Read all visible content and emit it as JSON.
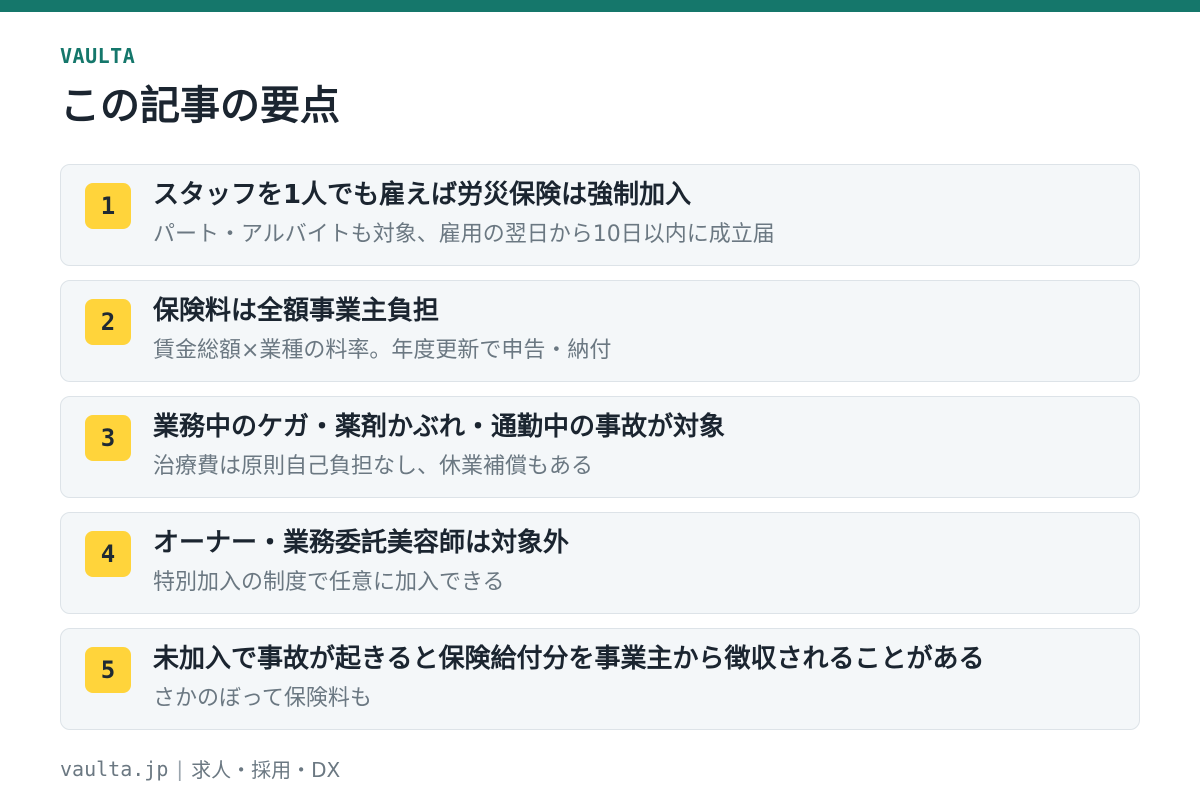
{
  "brand": "VAULTA",
  "title": "この記事の要点",
  "points": [
    {
      "num": "1",
      "title": "スタッフを1人でも雇えば労災保険は強制加入",
      "sub": "パート・アルバイトも対象、雇用の翌日から10日以内に成立届"
    },
    {
      "num": "2",
      "title": "保険料は全額事業主負担",
      "sub": "賃金総額×業種の料率。年度更新で申告・納付"
    },
    {
      "num": "3",
      "title": "業務中のケガ・薬剤かぶれ・通勤中の事故が対象",
      "sub": "治療費は原則自己負担なし、休業補償もある"
    },
    {
      "num": "4",
      "title": "オーナー・業務委託美容師は対象外",
      "sub": "特別加入の制度で任意に加入できる"
    },
    {
      "num": "5",
      "title": "未加入で事故が起きると保険給付分を事業主から徴収されることがある",
      "sub": "さかのぼって保険料も"
    }
  ],
  "footer": {
    "domain": "vaulta.jp",
    "separator": "|",
    "tagline": "求人・採用・DX"
  },
  "colors": {
    "accent": "#15776b",
    "badge": "#ffd43b",
    "card_bg": "#f4f7f9"
  }
}
